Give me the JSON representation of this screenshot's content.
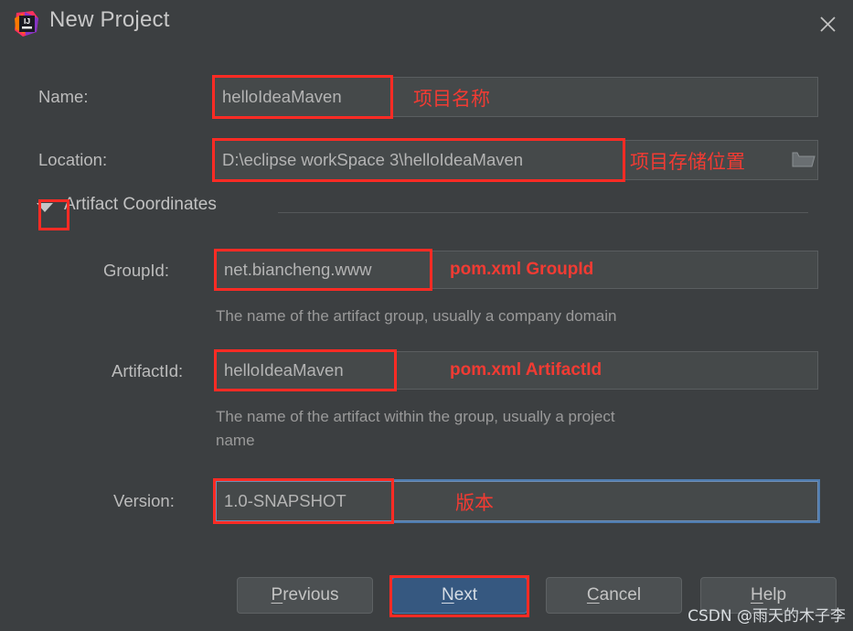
{
  "window": {
    "title": "New Project",
    "app_icon": "intellij-idea-icon",
    "icon_text": "IJ",
    "close_icon": "close-icon"
  },
  "theme": {
    "background": "#3c3f41",
    "field_background": "#45494a",
    "annotation_red": "#ff2b24",
    "primary_blue": "#365880",
    "focus_blue": "#4e7cb0",
    "text": "#bcbcbc",
    "hint_text": "#9a9a9a"
  },
  "form": {
    "name": {
      "label": "Name:",
      "value": "helloIdeaMaven",
      "annotation": "项目名称"
    },
    "location": {
      "label": "Location:",
      "value": "D:\\eclipse workSpace 3\\helloIdeaMaven",
      "annotation": "项目存储位置",
      "browse_icon": "folder-icon"
    },
    "artifact_coordinates": {
      "title": "Artifact Coordinates",
      "expanded": true,
      "toggle_icon": "triangle-down-icon"
    },
    "group_id": {
      "label": "GroupId:",
      "value": "net.biancheng.www",
      "annotation": "pom.xml GroupId",
      "hint": "The name of the artifact group, usually a company domain"
    },
    "artifact_id": {
      "label": "ArtifactId:",
      "value": "helloIdeaMaven",
      "annotation": "pom.xml ArtifactId",
      "hint": "The name of the artifact within the group, usually a project\nname"
    },
    "version": {
      "label": "Version:",
      "value": "1.0-SNAPSHOT",
      "annotation": "版本",
      "focused": true
    }
  },
  "buttons": {
    "previous": {
      "label": "Previous",
      "mnemonic": "P",
      "rest": "revious"
    },
    "next": {
      "label": "Next",
      "mnemonic": "N",
      "rest": "ext",
      "primary": true
    },
    "cancel": {
      "label": "Cancel",
      "mnemonic": "C",
      "rest": "ancel"
    },
    "help": {
      "label": "Help",
      "mnemonic": "H",
      "rest": "elp"
    }
  },
  "watermark": "CSDN @雨天的木子李"
}
